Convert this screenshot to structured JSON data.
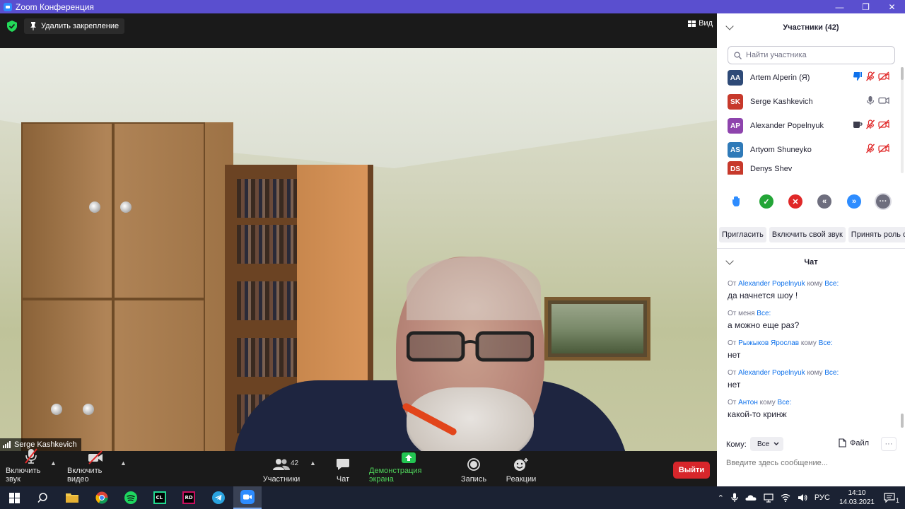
{
  "window": {
    "title": "Zoom Конференция"
  },
  "video": {
    "unpin_label": "Удалить закрепление",
    "view_label": "Вид",
    "speaker_name": "Serge Kashkevich"
  },
  "toolbar": {
    "mute_label": "Включить звук",
    "video_label": "Включить видео",
    "participants_label": "Участники",
    "participants_count": "42",
    "chat_label": "Чат",
    "share_label": "Демонстрация экрана",
    "record_label": "Запись",
    "reactions_label": "Реакции",
    "leave_label": "Выйти"
  },
  "participants_panel": {
    "title": "Участники (42)",
    "search_placeholder": "Найти участника",
    "items": [
      {
        "initials": "AA",
        "name": "Artem Alperin (Я)",
        "color": "#2e4a77"
      },
      {
        "initials": "SK",
        "name": "Serge Kashkevich",
        "color": "#c7392b"
      },
      {
        "initials": "AP",
        "name": "Alexander Popelnyuk",
        "color": "#8e44ad"
      },
      {
        "initials": "AS",
        "name": "Artyom Shuneyko",
        "color": "#2f7ab8"
      },
      {
        "initials": "DS",
        "name": "Denys Shev",
        "color": "#c7392b"
      }
    ],
    "actions": [
      "Пригласить",
      "Включить свой звук",
      "Принять роль орга"
    ]
  },
  "chat_panel": {
    "title": "Чат",
    "messages": [
      {
        "from_prefix": "От",
        "from": "Alexander Popelnyuk",
        "to_prefix": "кому",
        "to": "Все:",
        "text": "да начнется шоу !"
      },
      {
        "from_prefix": "От",
        "from": "меня",
        "to_prefix": "",
        "to": "Все:",
        "text": "а можно еще раз?"
      },
      {
        "from_prefix": "От",
        "from": "Рыжыков Ярослав",
        "to_prefix": "кому",
        "to": "Все:",
        "text": "нет"
      },
      {
        "from_prefix": "От",
        "from": "Alexander Popelnyuk",
        "to_prefix": "кому",
        "to": "Все:",
        "text": "нет"
      },
      {
        "from_prefix": "От",
        "from": "Антон",
        "to_prefix": "кому",
        "to": "Все:",
        "text": "какой-то кринж"
      }
    ],
    "to_label": "Кому:",
    "to_value": "Все",
    "file_label": "Файл",
    "more_label": "···",
    "input_placeholder": "Введите здесь сообщение..."
  },
  "taskbar": {
    "lang": "РУС",
    "time": "14:10",
    "date": "14.03.2021",
    "notification_count": "1"
  }
}
